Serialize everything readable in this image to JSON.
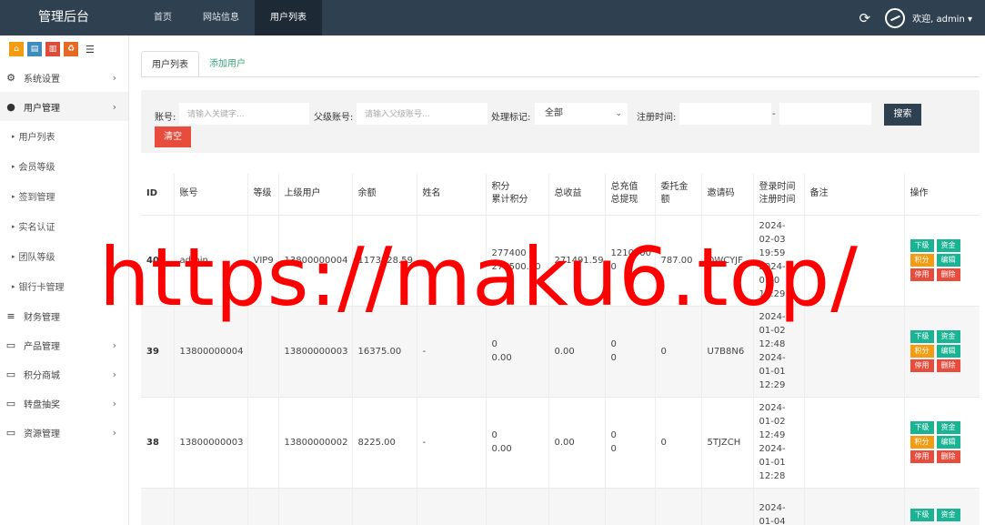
{
  "header": {
    "brand": "管理后台",
    "nav": [
      "首页",
      "网站信息",
      "用户列表"
    ],
    "welcome": "欢迎, admin ▾"
  },
  "sidebar": {
    "quick_icons": [
      "home-icon",
      "file-icon",
      "trash-icon",
      "recycle-icon",
      "list-icon"
    ],
    "menu": [
      {
        "label": "系统设置",
        "icon": "gears-icon"
      },
      {
        "label": "用户管理",
        "icon": "user-icon"
      }
    ],
    "submenu": [
      "用户列表",
      "会员等级",
      "签到管理",
      "实名认证",
      "团队等级",
      "银行卡管理"
    ],
    "menu2": [
      {
        "label": "财务管理",
        "icon": "database-icon"
      },
      {
        "label": "产品管理",
        "icon": "monitor-icon"
      },
      {
        "label": "积分商城",
        "icon": "monitor-icon"
      },
      {
        "label": "转盘抽奖",
        "icon": "monitor-icon"
      },
      {
        "label": "资源管理",
        "icon": "monitor-icon"
      }
    ]
  },
  "tabs": [
    "用户列表",
    "添加用户"
  ],
  "search": {
    "account_label": "账号:",
    "account_placeholder": "请输入关键字...",
    "parent_label": "父级账号:",
    "parent_placeholder": "请输入父级账号...",
    "flag_label": "处理标记:",
    "flag_value": "全部",
    "time_label": "注册时间:",
    "dash": "-",
    "search_btn": "搜索",
    "clear_btn": "清空"
  },
  "table": {
    "headers": [
      "ID",
      "账号",
      "等级",
      "上级用户",
      "余额",
      "姓名",
      "积分\n累计积分",
      "总收益",
      "总充值\n总提现",
      "委托金\n额",
      "邀请码",
      "登录时间\n注册时间",
      "备注",
      "操作"
    ],
    "rows": [
      {
        "id": "40",
        "account": "admin",
        "level": "VIP9",
        "parent": "13800000004",
        "balance": "1173828.59",
        "name": "-",
        "points": "277400\n277500.00",
        "income": "271491.59",
        "recharge": "1210000\n0",
        "entrust": "787.00",
        "invite": "OWCYJF",
        "times": "2024-\n02-03\n19:59\n2024-\n01-0\n12:29",
        "note": ""
      },
      {
        "id": "39",
        "account": "13800000004",
        "level": "",
        "parent": "13800000003",
        "balance": "16375.00",
        "name": "-",
        "points": "0\n0.00",
        "income": "0.00",
        "recharge": "0\n0",
        "entrust": "0",
        "invite": "U7B8N6",
        "times": "2024-\n01-02\n12:48\n2024-\n01-01\n12:29",
        "note": ""
      },
      {
        "id": "38",
        "account": "13800000003",
        "level": "",
        "parent": "13800000002",
        "balance": "8225.00",
        "name": "-",
        "points": "0\n0.00",
        "income": "0.00",
        "recharge": "0\n0",
        "entrust": "0",
        "invite": "5TJZCH",
        "times": "2024-\n01-02\n12:49\n2024-\n01-01\n12:28",
        "note": ""
      },
      {
        "id": "",
        "account": "",
        "level": "",
        "parent": "",
        "balance": "",
        "name": "",
        "points": "",
        "income": "",
        "recharge": "",
        "entrust": "",
        "invite": "",
        "times": "2024-\n01-04",
        "note": ""
      }
    ],
    "ops": [
      "下级",
      "资金",
      "积分",
      "编辑",
      "停用",
      "删除"
    ]
  },
  "watermark": "https://maku6.top/",
  "colors": {
    "topbar": "#2f4050",
    "green": "#1ab394",
    "orange": "#f39c12",
    "red": "#e74c3c"
  }
}
